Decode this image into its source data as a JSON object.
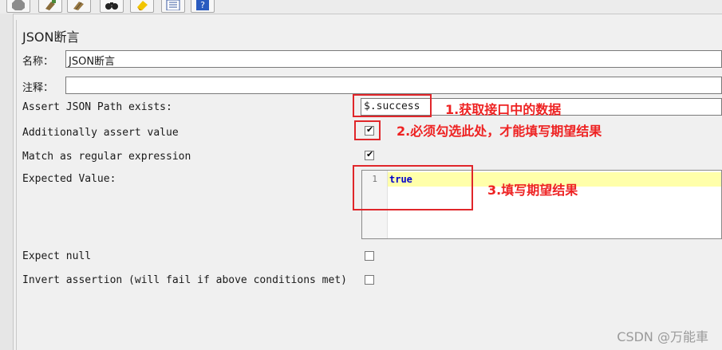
{
  "panel": {
    "title": "JSON断言"
  },
  "fields": {
    "name_label": "名称：",
    "name_value": "JSON断言",
    "comment_label": "注释：",
    "comment_value": ""
  },
  "options": {
    "assert_path_label": "Assert JSON Path exists:",
    "assert_path_value": "$.success",
    "additionally_label": "Additionally assert value",
    "additionally_checked": true,
    "regex_label": "Match as regular expression",
    "regex_checked": true,
    "expected_label": "Expected Value:",
    "expect_null_label": "Expect null",
    "expect_null_checked": false,
    "invert_label": "Invert assertion (will fail if above conditions met)",
    "invert_checked": false
  },
  "editor": {
    "line_number": "1",
    "value": "true",
    "highlight_color": "#ffffaa"
  },
  "check_mark": "✔",
  "annotations": {
    "a1": "1.获取接口中的数据",
    "a2": "2.必须勾选此处，才能填写期望结果",
    "a3": "3.填写期望结果",
    "color": "#ee2222"
  },
  "toolbar": [
    "stop-icon",
    "broom-icon",
    "broom-all-icon",
    "binoculars-icon",
    "clear-search-icon",
    "function-list-icon",
    "help-icon"
  ],
  "watermark": "CSDN @万能車"
}
